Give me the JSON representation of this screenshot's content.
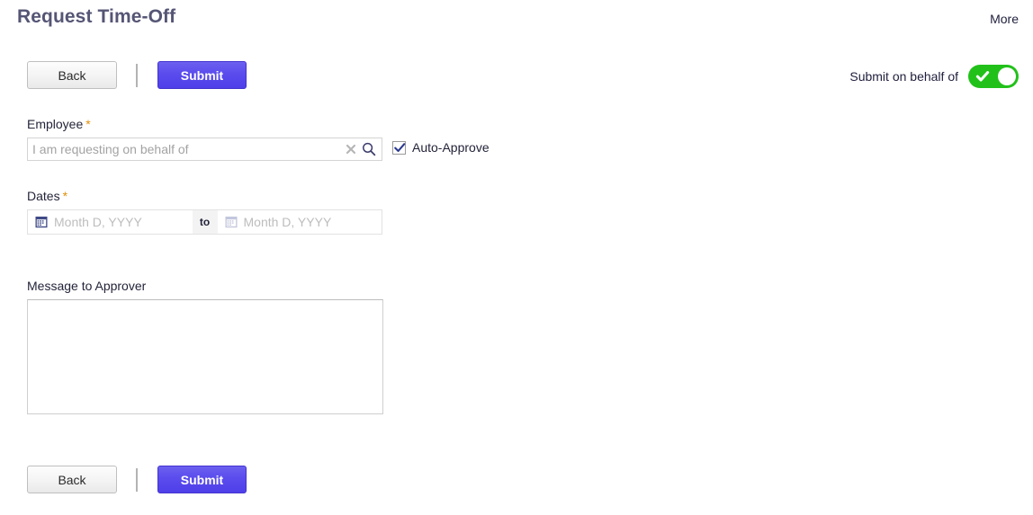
{
  "header": {
    "title": "Request Time-Off",
    "more_label": "More"
  },
  "toolbar": {
    "back_label": "Back",
    "submit_label": "Submit"
  },
  "behalf": {
    "label": "Submit on behalf of",
    "toggle_state": "on",
    "toggle_color": "#22c11a"
  },
  "form": {
    "employee": {
      "label": "Employee",
      "required_marker": "*",
      "placeholder": "I am requesting on behalf of",
      "value": "",
      "clear_icon": "clear-icon",
      "search_icon": "search-icon"
    },
    "auto_approve": {
      "label": "Auto-Approve",
      "checked": true
    },
    "dates": {
      "label": "Dates",
      "required_marker": "*",
      "start_placeholder": "Month D, YYYY",
      "start_value": "",
      "separator": "to",
      "end_placeholder": "Month D, YYYY",
      "end_value": ""
    },
    "message": {
      "label": "Message to Approver",
      "value": "",
      "placeholder": ""
    }
  },
  "footer": {
    "back_label": "Back",
    "submit_label": "Submit"
  },
  "colors": {
    "title": "#555575",
    "accent_submit": "#5a4ced",
    "required_star": "#e0900c",
    "toggle_on": "#22c11a"
  }
}
